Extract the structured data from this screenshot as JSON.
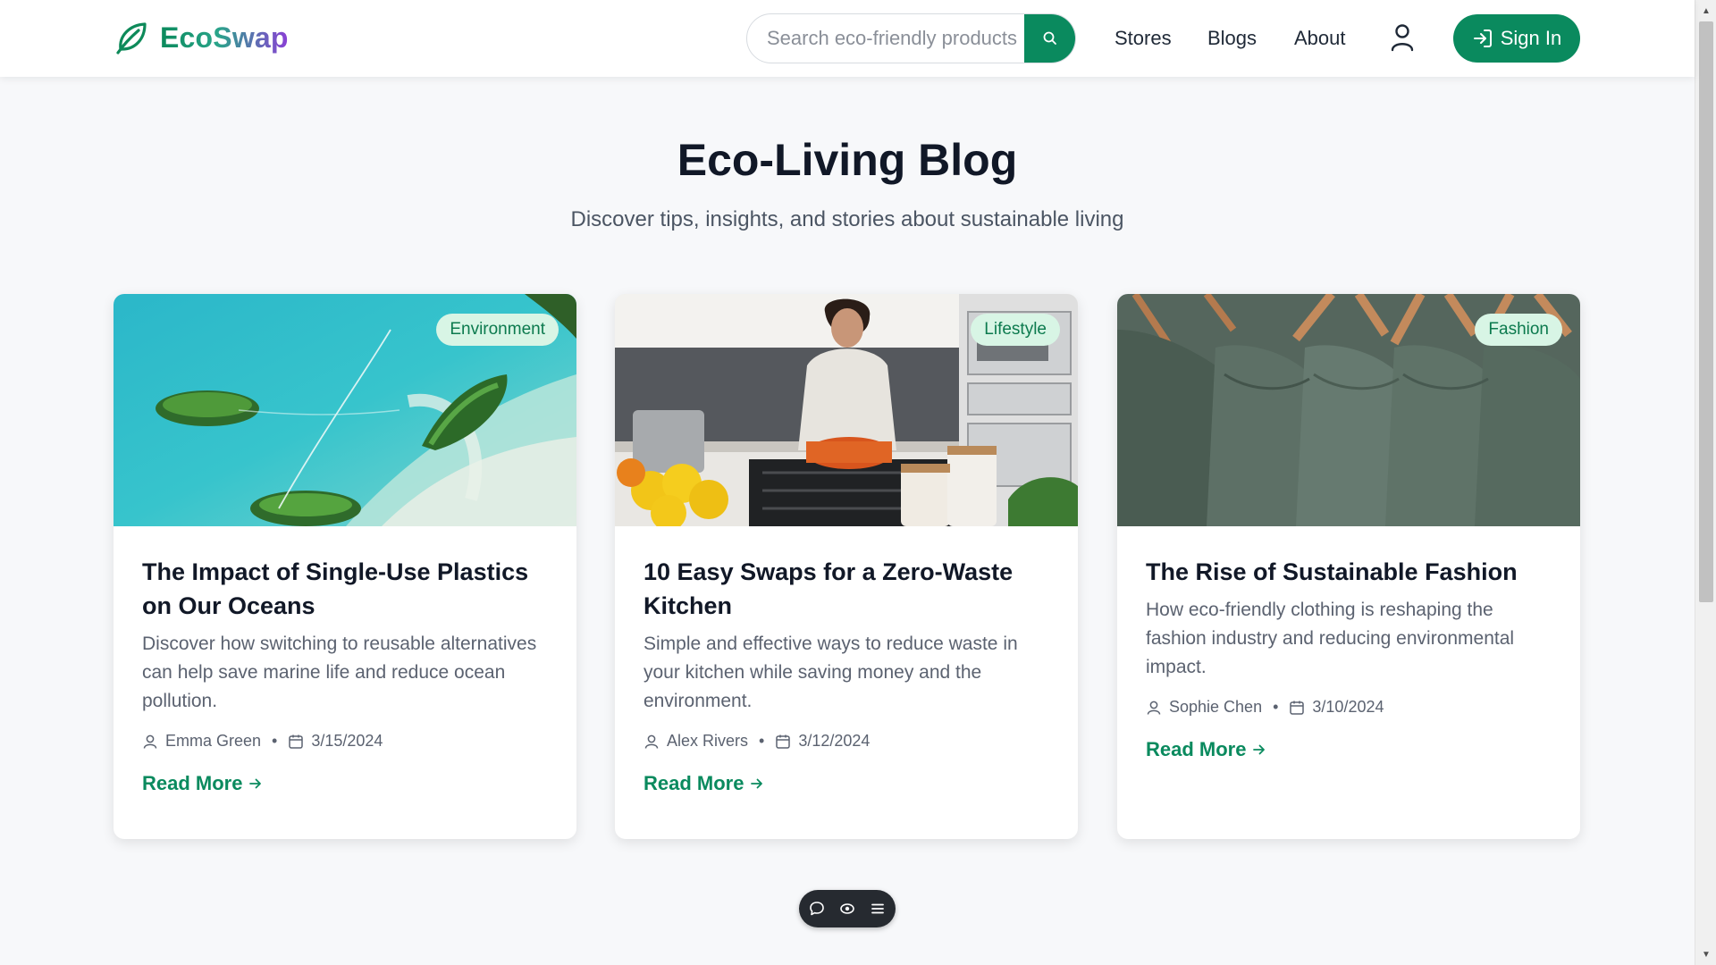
{
  "brand": {
    "name": "EcoSwap",
    "accent": "#0a8a5e"
  },
  "search": {
    "placeholder": "Search eco-friendly products",
    "value": ""
  },
  "nav": {
    "links": [
      {
        "label": "Stores"
      },
      {
        "label": "Blogs"
      },
      {
        "label": "About"
      }
    ],
    "sign_in_label": "Sign In"
  },
  "hero": {
    "title": "Eco-Living Blog",
    "subtitle": "Discover tips, insights, and stories about sustainable living"
  },
  "posts": [
    {
      "category": "Environment",
      "title": "The Impact of Single-Use Plastics on Our Oceans",
      "excerpt": "Discover how switching to reusable alternatives can help save marine life and reduce ocean pollution.",
      "author": "Emma Green",
      "date": "3/15/2024",
      "read_more": "Read More",
      "image": "aerial-ocean-islands"
    },
    {
      "category": "Lifestyle",
      "title": "10 Easy Swaps for a Zero-Waste Kitchen",
      "excerpt": "Simple and effective ways to reduce waste in your kitchen while saving money and the environment.",
      "author": "Alex Rivers",
      "date": "3/12/2024",
      "read_more": "Read More",
      "image": "woman-cooking-kitchen"
    },
    {
      "category": "Fashion",
      "title": "The Rise of Sustainable Fashion",
      "excerpt": "How eco-friendly clothing is reshaping the fashion industry and reducing environmental impact.",
      "author": "Sophie Chen",
      "date": "3/10/2024",
      "read_more": "Read More",
      "image": "green-shirts-on-hangers"
    }
  ],
  "toolbar": {
    "icons": [
      "comment-icon",
      "eye-icon",
      "menu-icon"
    ]
  }
}
